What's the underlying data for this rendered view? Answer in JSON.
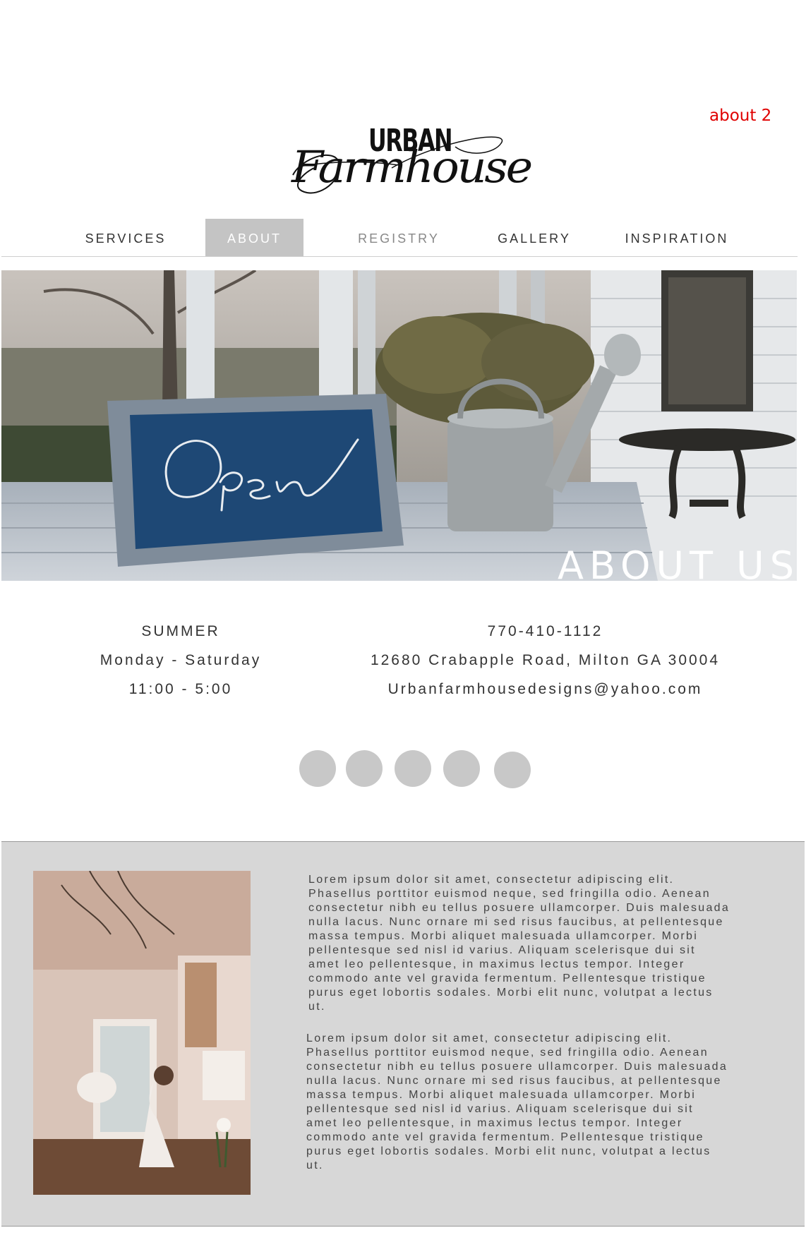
{
  "corner_label": "about 2",
  "logo": {
    "line1": "URBAN",
    "line2": "Farmhouse"
  },
  "nav": {
    "items": [
      {
        "label": "SERVICES",
        "state": "normal"
      },
      {
        "label": "ABOUT",
        "state": "active"
      },
      {
        "label": "REGISTRY",
        "state": "muted"
      },
      {
        "label": "GALLERY",
        "state": "normal"
      },
      {
        "label": "INSPIRATION",
        "state": "normal"
      }
    ]
  },
  "hero": {
    "sign_text": "Open",
    "title": "ABOUT US"
  },
  "hours": {
    "season": "SUMMER",
    "days": "Monday - Saturday",
    "time": "11:00 - 5:00"
  },
  "contact": {
    "phone": "770-410-1112",
    "address": "12680 Crabapple Road, Milton GA 30004",
    "email": "Urbanfarmhousedesigns@yahoo.com"
  },
  "social": {
    "icons": [
      "social-icon-1",
      "social-icon-2",
      "social-icon-3",
      "social-icon-4",
      "social-icon-5"
    ]
  },
  "about": {
    "paragraphs": [
      "Lorem ipsum dolor sit amet, consectetur adipiscing elit. Phasellus porttitor euismod neque, sed fringilla odio. Aenean consectetur nibh eu tellus posuere ullamcorper. Duis malesuada nulla lacus. Nunc ornare mi sed risus faucibus, at pellentesque massa tempus. Morbi aliquet malesuada ullamcorper. Morbi pellentesque sed nisl id varius. Aliquam scelerisque dui sit amet leo pellentesque, in maximus lectus tempor. Integer commodo ante vel gravida fermentum. Pellentesque tristique purus eget lobortis sodales. Morbi elit nunc, volutpat a lectus ut.",
      "Lorem ipsum dolor sit amet, consectetur adipiscing elit. Phasellus porttitor euismod neque, sed fringilla odio. Aenean consectetur nibh eu tellus posuere ullamcorper. Duis malesuada nulla lacus. Nunc ornare mi sed risus faucibus, at pellentesque massa tempus. Morbi aliquet malesuada ullamcorper. Morbi pellentesque sed nisl id varius. Aliquam scelerisque dui sit amet leo pellentesque, in maximus lectus tempor. Integer commodo ante vel gravida fermentum. Pellentesque tristique purus eget lobortis sodales. Morbi elit nunc, volutpat a lectus ut."
    ]
  },
  "colors": {
    "accent_red": "#e00000",
    "nav_active_bg": "#c4c4c4",
    "section_bg": "#d7d7d7",
    "social_circle": "#c8c8c8"
  }
}
